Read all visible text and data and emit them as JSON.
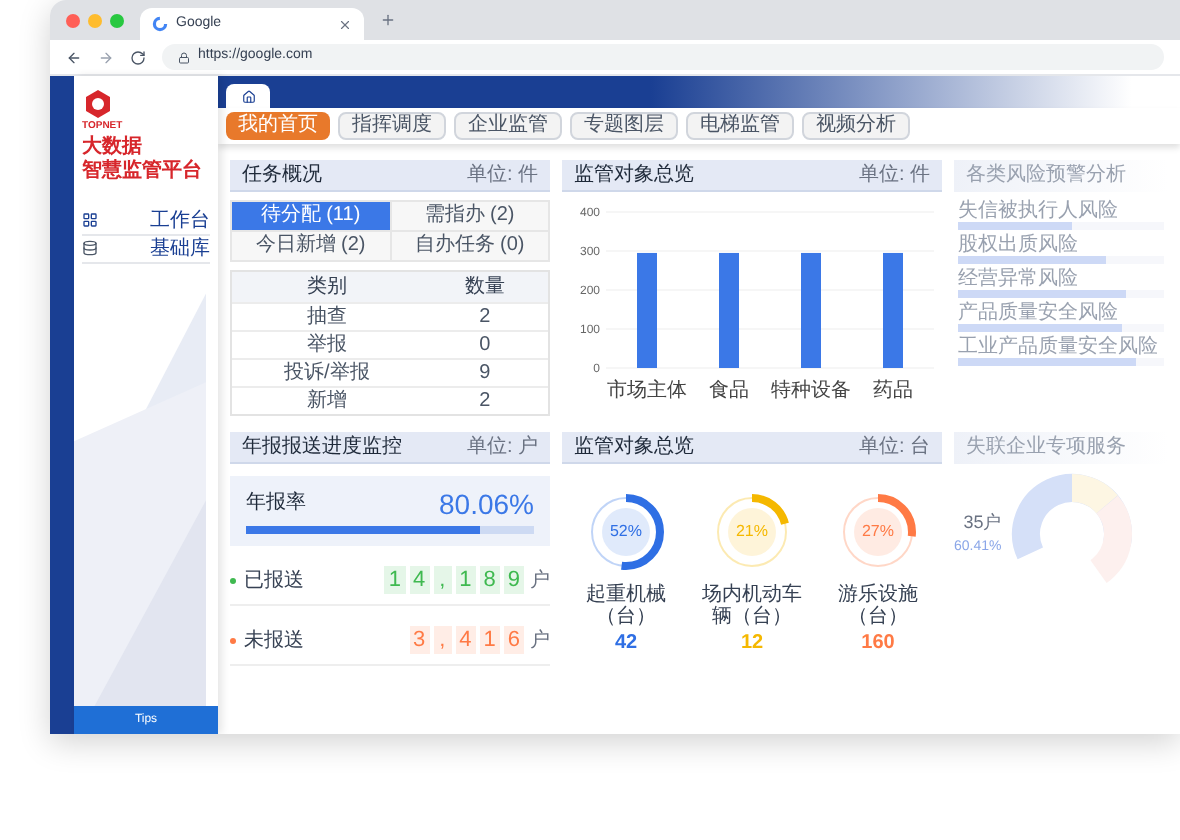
{
  "browser": {
    "tab_title": "Google",
    "url": "https://google.com"
  },
  "brand": {
    "company": "TOPNET",
    "line1": "大数据",
    "line2": "智慧监管平台"
  },
  "sidebar": {
    "items": [
      {
        "label": "工作台",
        "kind": "grid"
      },
      {
        "label": "基础库",
        "kind": "database"
      }
    ],
    "tips": "Tips"
  },
  "nav_tabs": [
    {
      "label": "我的首页",
      "selected": true
    },
    {
      "label": "指挥调度",
      "selected": false
    },
    {
      "label": "企业监管",
      "selected": false
    },
    {
      "label": "专题图层",
      "selected": false
    },
    {
      "label": "电梯监管",
      "selected": false
    },
    {
      "label": "视频分析",
      "selected": false
    }
  ],
  "task_panel": {
    "title": "任务概况",
    "unit": "单位: 件",
    "tabs": [
      {
        "label": "待分配 (11)",
        "selected": true
      },
      {
        "label": "需指办 (2)",
        "selected": false
      },
      {
        "label": "今日新增 (2)",
        "selected": false
      },
      {
        "label": "自办任务 (0)",
        "selected": false
      }
    ],
    "columns": [
      "类别",
      "数量"
    ],
    "rows": [
      [
        "抽查",
        "2"
      ],
      [
        "举报",
        "0"
      ],
      [
        "投诉/举报",
        "9"
      ],
      [
        "新增",
        "2"
      ]
    ]
  },
  "object_panel": {
    "title": "监管对象总览",
    "unit": "单位: 件",
    "chart_data": {
      "type": "bar",
      "categories": [
        "市场主体",
        "食品",
        "特种设备",
        "药品"
      ],
      "series": [
        {
          "color": "#3b78e7",
          "values": [
            295,
            295,
            295,
            295
          ]
        }
      ],
      "ylim": [
        0,
        400
      ],
      "grid": true,
      "yticks": [
        0,
        100,
        200,
        300,
        400
      ]
    }
  },
  "risk_panel": {
    "title": "各类风险预警分析",
    "items": [
      {
        "label": "失信被执行人风险",
        "level": 0.55
      },
      {
        "label": "股权出质风险",
        "level": 0.72
      },
      {
        "label": "经营异常风险",
        "level": 0.82
      },
      {
        "label": "产品质量安全风险",
        "level": 0.8
      },
      {
        "label": "工业产品质量安全风险",
        "level": 0.86
      }
    ]
  },
  "report_panel": {
    "title": "年报报送进度监控",
    "unit": "单位: 户",
    "rate_label": "年报率",
    "rate": "80.06%",
    "level": 0.81,
    "rows": [
      {
        "label": "已报送",
        "digits": [
          "1",
          "4",
          ",",
          "1",
          "8",
          "9"
        ],
        "suffix": "户",
        "color": "#3fb950"
      },
      {
        "label": "未报送",
        "digits": [
          "3",
          ",",
          "4",
          "1",
          "6"
        ],
        "suffix": "户",
        "color": "#ff7a45"
      }
    ]
  },
  "equipment_panel": {
    "title": "监管对象总览",
    "unit": "单位: 台",
    "rings": [
      {
        "percent": "52%",
        "level": 0.52,
        "label": "起重机械（台）",
        "count": "42",
        "color": "#2f6fe4"
      },
      {
        "percent": "21%",
        "level": 0.21,
        "label": "场内机动车辆（台）",
        "count": "12",
        "color": "#f5b800"
      },
      {
        "percent": "27%",
        "level": 0.27,
        "label": "游乐设施（台）",
        "count": "160",
        "color": "#ff7a45"
      }
    ]
  },
  "lost_panel": {
    "title": "失联企业专项服务",
    "count": "35户",
    "percent": "60.41%"
  }
}
